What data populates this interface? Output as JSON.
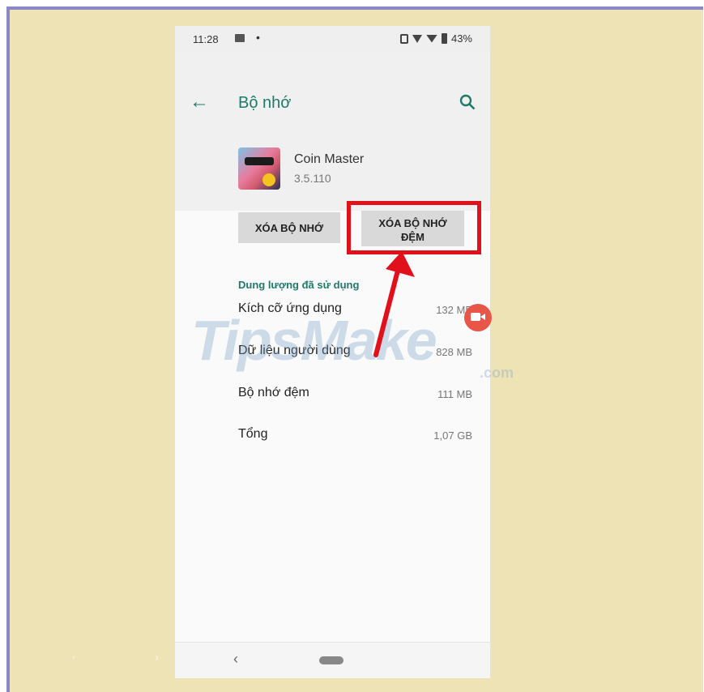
{
  "status_bar": {
    "time": "11:28",
    "dot": "•",
    "battery": "43%"
  },
  "header": {
    "title": "Bộ nhớ",
    "back_icon": "←"
  },
  "app": {
    "name": "Coin Master",
    "version": "3.5.110"
  },
  "buttons": {
    "clear_storage": "XÓA BỘ NHỚ",
    "clear_cache_line1": "XÓA BỘ NHỚ",
    "clear_cache_line2": "ĐỆM"
  },
  "storage": {
    "section_title": "Dung lượng đã sử dụng",
    "rows": [
      {
        "label": "Kích cỡ ứng dụng",
        "value": "132 MB"
      },
      {
        "label": "Dữ liệu người dùng",
        "value": "828 MB"
      },
      {
        "label": "Bộ nhớ đệm",
        "value": "111 MB"
      },
      {
        "label": "Tổng",
        "value": "1,07 GB"
      }
    ]
  },
  "watermark": {
    "text": "TipsMake",
    "suffix": ".com"
  },
  "navbar": {
    "back": "‹"
  },
  "colors": {
    "accent": "#1f7a6c",
    "highlight": "#e1111b",
    "background": "#eee3b5"
  }
}
